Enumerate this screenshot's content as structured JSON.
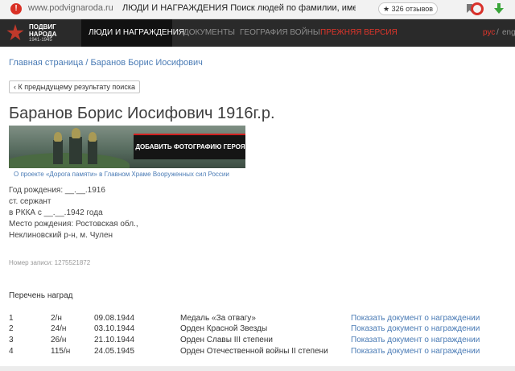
{
  "browser": {
    "url": "www.podvignaroda.ru",
    "page_title": "ЛЮДИ И НАГРАЖДЕНИЯ Поиск людей по фамилии, имени,...",
    "reviews": "★ 326 отзывов"
  },
  "site": {
    "logo_line1": "ПОДВИГ",
    "logo_line2": "НАРОДА",
    "logo_years": "1941-1945",
    "nav": [
      {
        "label": "ЛЮДИ И НАГРАЖДЕНИЯ"
      },
      {
        "label": "ДОКУМЕНТЫ"
      },
      {
        "label": "ГЕОГРАФИЯ ВОЙНЫ"
      },
      {
        "label": "ПРЕЖНЯЯ ВЕРСИЯ"
      }
    ],
    "lang_ru": "рус",
    "lang_sep": "/",
    "lang_en": "eng"
  },
  "breadcrumb": {
    "home": "Главная страница",
    "sep": " / ",
    "current": "Баранов Борис Иосифович"
  },
  "back_button": "К предыдущему результату поиска",
  "person": {
    "title": "Баранов Борис Иосифович 1916г.р.",
    "banner_button": "ДОБАВИТЬ ФОТОГРАФИЮ ГЕРОЯ",
    "banner_caption": "О проекте «Дорога памяти» в Главном Храме Вооруженных сил России",
    "info_lines": [
      "Год рождения: __.__.1916",
      "ст. сержант",
      "в РККА с __.__.1942 года",
      "Место рождения: Ростовская обл.,",
      "Неклиновский р-н, м. Чулен"
    ],
    "record_number": "Номер записи: 1275521872"
  },
  "awards": {
    "heading": "Перечень наград",
    "rows": [
      {
        "n": "1",
        "num": "2/н",
        "date": "09.08.1944",
        "name": "Медаль «За отвагу»",
        "link": "Показать документ о награждении"
      },
      {
        "n": "2",
        "num": "24/н",
        "date": "03.10.1944",
        "name": "Орден Красной Звезды",
        "link": "Показать документ о награждении"
      },
      {
        "n": "3",
        "num": "26/н",
        "date": "21.10.1944",
        "name": "Орден Славы III степени",
        "link": "Показать документ о награждении"
      },
      {
        "n": "4",
        "num": "115/н",
        "date": "24.05.1945",
        "name": "Орден Отечественной войны II степени",
        "link": "Показать документ о награждении"
      }
    ]
  }
}
